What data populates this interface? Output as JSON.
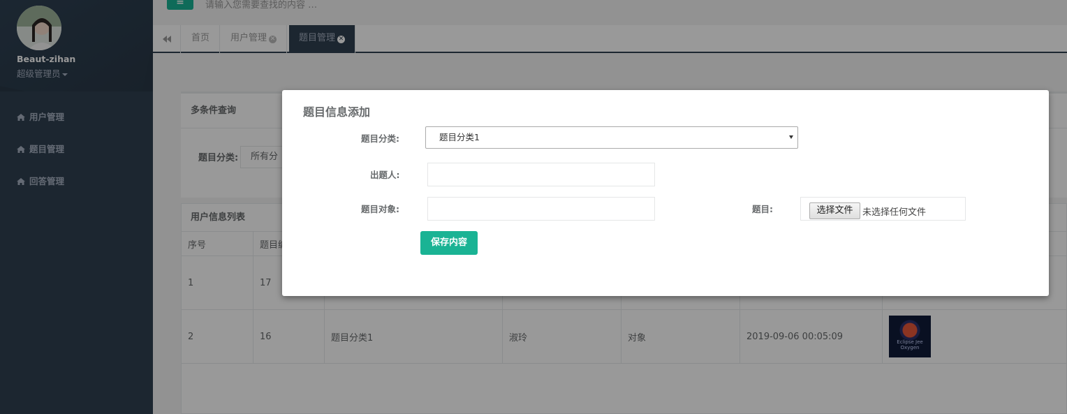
{
  "sidebar": {
    "profile_name": "Beaut-zihan",
    "profile_role": "超级管理员",
    "items": [
      {
        "label": "用户管理"
      },
      {
        "label": "题目管理"
      },
      {
        "label": "回答管理"
      }
    ]
  },
  "topbar": {
    "menu_icon": "≡",
    "search_placeholder": "请输入您需要查找的内容 …"
  },
  "tabs": [
    {
      "label": "首页"
    },
    {
      "label": "用户管理"
    },
    {
      "label": "题目管理"
    }
  ],
  "filter": {
    "title": "多条件查询",
    "category_label": "题目分类:",
    "category_value": "所有分"
  },
  "table": {
    "title": "用户信息列表",
    "headers": [
      "序号",
      "题目编"
    ],
    "rows": [
      {
        "index": "1",
        "id": "17",
        "category": "",
        "author": "",
        "target": "",
        "time": ""
      },
      {
        "index": "2",
        "id": "16",
        "category": "题目分类1",
        "author": "淑玲",
        "target": "对象",
        "time": "2019-09-06 00:05:09",
        "thumb_text": "Eclipse Jee Oxygen"
      }
    ]
  },
  "modal": {
    "title": "题目信息添加",
    "category_label": "题目分类:",
    "category_value": "题目分类1",
    "author_label": "出题人:",
    "target_label": "题目对象:",
    "question_label": "题目:",
    "file_button": "选择文件",
    "file_status": "未选择任何文件",
    "save_label": "保存内容"
  },
  "colors": {
    "sidebar": "#2f4050",
    "accent": "#1ab394"
  }
}
